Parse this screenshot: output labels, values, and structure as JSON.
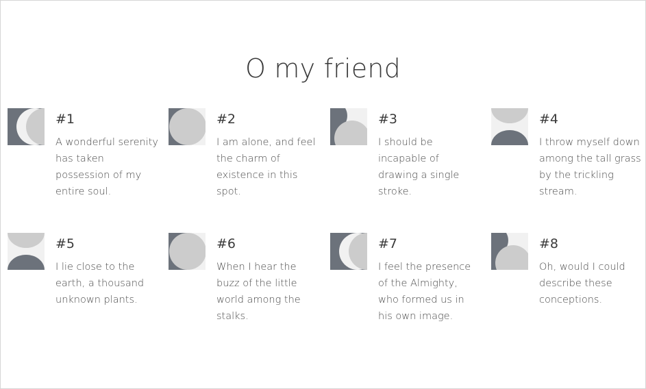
{
  "page": {
    "title": "O my friend"
  },
  "colors": {
    "dark": "#6c727b",
    "light": "#cccccc",
    "pale": "#f1f1f1"
  },
  "items": [
    {
      "number": "#1",
      "text": "A wonderful serenity has taken possession of my entire soul.",
      "icon": "half-circles-left-icon"
    },
    {
      "number": "#2",
      "text": "I am alone, and feel the charm of existence in this spot.",
      "icon": "circle-on-dark-icon"
    },
    {
      "number": "#3",
      "text": "I should be incapable of drawing a single stroke.",
      "icon": "quarter-circle-icon"
    },
    {
      "number": "#4",
      "text": "I throw myself down among the tall grass by the trickling stream.",
      "icon": "half-circles-vertical-icon"
    },
    {
      "number": "#5",
      "text": "I lie close to the earth, a thousand unknown plants.",
      "icon": "half-circles-vertical-alt-icon"
    },
    {
      "number": "#6",
      "text": "When I hear the buzz of the little world among the stalks.",
      "icon": "circle-on-dark-alt-icon"
    },
    {
      "number": "#7",
      "text": "I feel the presence of the Almighty, who formed us in his own image.",
      "icon": "half-circles-right-icon"
    },
    {
      "number": "#8",
      "text": "Oh, would I could describe these conceptions.",
      "icon": "quarter-circle-alt-icon"
    }
  ]
}
